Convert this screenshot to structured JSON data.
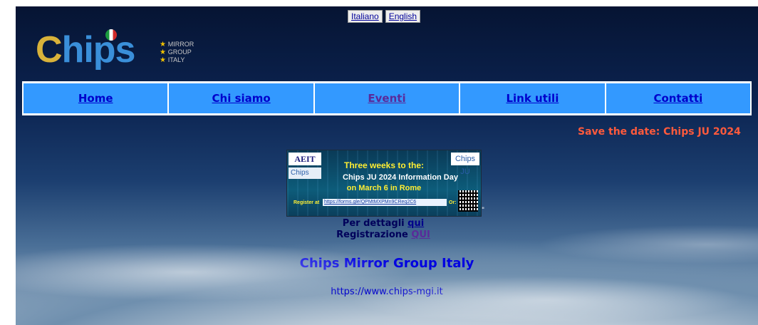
{
  "language_switcher": {
    "italian_label": "Italiano",
    "english_label": "English"
  },
  "logo": {
    "word_c": "C",
    "word_rest": "hips",
    "tags": [
      "MIRROR",
      "GROUP",
      "ITALY"
    ]
  },
  "nav": {
    "items": [
      {
        "label": "Home"
      },
      {
        "label": "Chi siamo"
      },
      {
        "label": "Eventi"
      },
      {
        "label": "Link utili"
      },
      {
        "label": "Contatti"
      }
    ]
  },
  "ticker": {
    "text": "Save the date: Chips JU 2024"
  },
  "banner": {
    "aeit": "AEIT",
    "chips_left": "Chips",
    "chips_right": "Chips JU",
    "headline": "Three weeks to the:",
    "event": "Chips JU 2024 Information Day",
    "when_where": "on March 6 in Rome",
    "register_label": "Register at",
    "register_url": "https://forms.gle/QPMtMXPMn9CReq2C6",
    "or_label": "Or:",
    "quote": "\""
  },
  "details": {
    "per_dettagli": "Per dettagli",
    "qui_link": "qui",
    "registrazione": "Registrazione",
    "qui_caps_link": "QUI"
  },
  "site": {
    "title": "Chips Mirror Group Italy",
    "url": "https://www.chips-mgi.it"
  },
  "colors": {
    "nav_bg": "#3399ff",
    "link": "#0000cc",
    "visited_link": "#5a2a9a",
    "ticker": "#ff5a3c"
  }
}
